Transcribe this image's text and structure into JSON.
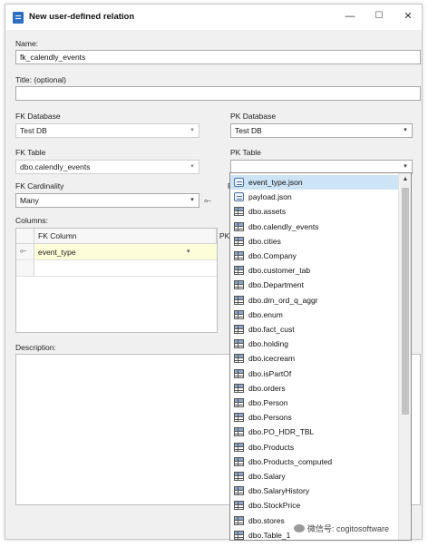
{
  "window": {
    "title": "New user-defined relation",
    "minimize": "—",
    "maximize": "☐",
    "close": "✕"
  },
  "form": {
    "name_label": "Name:",
    "name_value": "fk_calendly_events",
    "title_label": "Title: (optional)",
    "title_value": "",
    "fk_database_label": "FK Database",
    "fk_database_value": "Test DB",
    "pk_database_label": "PK Database",
    "pk_database_value": "Test DB",
    "fk_table_label": "FK Table",
    "fk_table_value": "dbo.calendly_events",
    "pk_table_label": "PK Table",
    "pk_table_value": "",
    "fk_cardinality_label": "FK Cardinality",
    "fk_cardinality_value": "Many",
    "pk_cardinality_label_fragment": "P",
    "columns_label": "Columns:",
    "description_label": "Description:"
  },
  "columns_grid": {
    "headers": [
      "FK Column",
      "PK"
    ],
    "rows": [
      {
        "fk_column": "event_type"
      }
    ]
  },
  "pk_table_dropdown": {
    "items": [
      {
        "label": "event_type.json",
        "icon": "json-file-icon",
        "highlighted": true
      },
      {
        "label": "payload.json",
        "icon": "json-file-icon"
      },
      {
        "label": "dbo.assets",
        "icon": "table-icon"
      },
      {
        "label": "dbo.calendly_events",
        "icon": "table-icon"
      },
      {
        "label": "dbo.cities",
        "icon": "table-icon"
      },
      {
        "label": "dbo.Company",
        "icon": "table-icon"
      },
      {
        "label": "dbo.customer_tab",
        "icon": "table-icon"
      },
      {
        "label": "dbo.Department",
        "icon": "table-icon"
      },
      {
        "label": "dbo.dm_ord_q_aggr",
        "icon": "table-icon"
      },
      {
        "label": "dbo.enum",
        "icon": "table-icon"
      },
      {
        "label": "dbo.fact_cust",
        "icon": "table-icon"
      },
      {
        "label": "dbo.holding",
        "icon": "table-icon"
      },
      {
        "label": "dbo.icecream",
        "icon": "table-icon"
      },
      {
        "label": "dbo.isPartOf",
        "icon": "table-icon"
      },
      {
        "label": "dbo.orders",
        "icon": "table-icon"
      },
      {
        "label": "dbo.Person",
        "icon": "table-icon"
      },
      {
        "label": "dbo.Persons",
        "icon": "table-icon"
      },
      {
        "label": "dbo.PO_HDR_TBL",
        "icon": "table-icon"
      },
      {
        "label": "dbo.Products",
        "icon": "table-icon"
      },
      {
        "label": "dbo.Products_computed",
        "icon": "table-icon"
      },
      {
        "label": "dbo.Salary",
        "icon": "table-icon"
      },
      {
        "label": "dbo.SalaryHistory",
        "icon": "table-icon"
      },
      {
        "label": "dbo.StockPrice",
        "icon": "table-icon"
      },
      {
        "label": "dbo.stores",
        "icon": "table-icon"
      },
      {
        "label": "dbo.Table_1",
        "icon": "table-icon"
      }
    ]
  },
  "watermark": "微信号: cogitosoftware",
  "colors": {
    "highlight": "#cde4f7",
    "selected_row": "#fdfdd9",
    "title_icon": "#2f6fc0"
  }
}
